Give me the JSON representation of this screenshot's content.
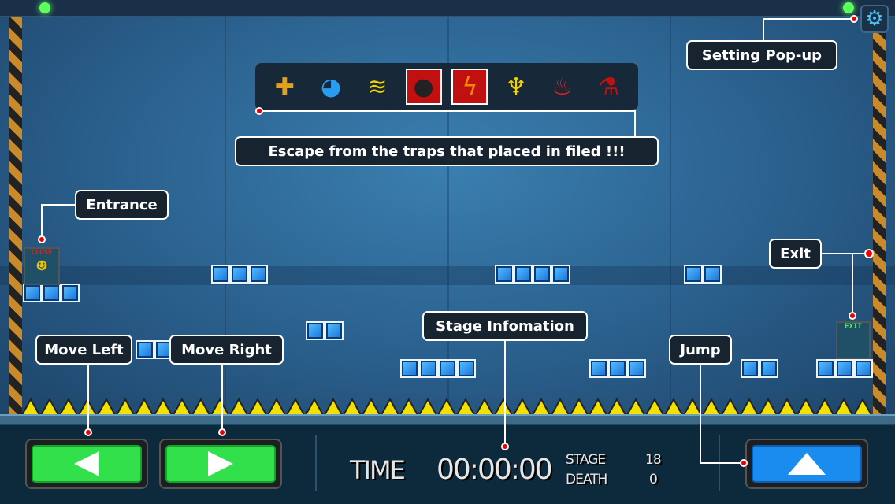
{
  "hud": {
    "time_label": "TIME",
    "time_value": "00:00:00",
    "stage_label": "STAGE",
    "stage_value": "18",
    "death_label": "DEATH",
    "death_value": "0"
  },
  "callouts": {
    "settings": "Setting Pop-up",
    "traps": "Escape from the traps that placed in filed !!!",
    "entrance": "Entrance",
    "exit": "Exit",
    "stage_info": "Stage Infomation",
    "move_left": "Move Left",
    "move_right": "Move Right",
    "jump": "Jump"
  },
  "doors": {
    "entrance_sign": "CLOSE",
    "exit_sign": "EXIT"
  },
  "traps": [
    {
      "name": "cross-turret-icon",
      "glyph": "✚",
      "color": "#e0a020"
    },
    {
      "name": "robot-ball-icon",
      "glyph": "◕",
      "color": "#2a9cf0"
    },
    {
      "name": "spring-icon",
      "glyph": "≋",
      "color": "#f2d400"
    },
    {
      "name": "bomb-icon",
      "glyph": "●",
      "color": "#222"
    },
    {
      "name": "crack-block-icon",
      "glyph": "ϟ",
      "color": "#f08a00"
    },
    {
      "name": "tesla-coil-icon",
      "glyph": "♆",
      "color": "#f2d400"
    },
    {
      "name": "flame-trap-icon",
      "glyph": "♨",
      "color": "#e02020"
    },
    {
      "name": "flask-trap-icon",
      "glyph": "⚗",
      "color": "#c01010"
    }
  ],
  "colors": {
    "move_button": "#31e04a",
    "jump_button": "#1a8cf0",
    "marker": "#e00000"
  }
}
